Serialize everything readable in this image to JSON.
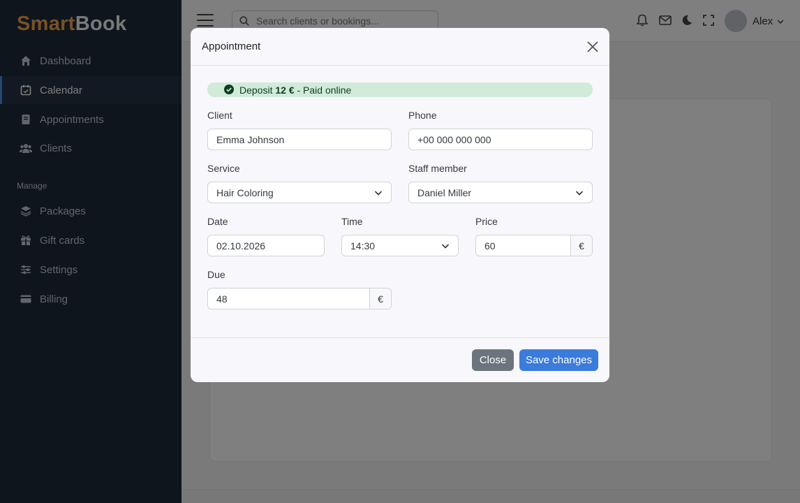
{
  "brand": {
    "part1": "Smart",
    "part2": "Book"
  },
  "sidebar": {
    "items": [
      {
        "label": "Dashboard",
        "icon": "home-icon"
      },
      {
        "label": "Calendar",
        "icon": "calendar-icon",
        "active": true
      },
      {
        "label": "Appointments",
        "icon": "book-icon"
      },
      {
        "label": "Clients",
        "icon": "users-icon"
      }
    ],
    "section_label": "Manage",
    "manage_items": [
      {
        "label": "Packages",
        "icon": "layers-icon"
      },
      {
        "label": "Gift cards",
        "icon": "gift-icon"
      },
      {
        "label": "Settings",
        "icon": "sliders-icon"
      },
      {
        "label": "Billing",
        "icon": "credit-card-icon"
      }
    ]
  },
  "topbar": {
    "search_placeholder": "Search clients or bookings...",
    "user_name": "Alex"
  },
  "modal": {
    "title": "Appointment",
    "alert": {
      "prefix": "Deposit",
      "amount": "12 €",
      "suffix": "- Paid online",
      "color": "#d1ebd9"
    },
    "client": {
      "label": "Client",
      "value": "Emma Johnson"
    },
    "phone": {
      "label": "Phone",
      "value": "+00 000 000 000"
    },
    "service": {
      "label": "Service",
      "value": "Hair Coloring"
    },
    "staff": {
      "label": "Staff member",
      "value": "Daniel Miller"
    },
    "date": {
      "label": "Date",
      "value": "02.10.2026"
    },
    "time": {
      "label": "Time",
      "value": "14:30"
    },
    "price": {
      "label": "Price",
      "value": "60",
      "currency": "€"
    },
    "due": {
      "label": "Due",
      "value": "48",
      "currency": "€"
    },
    "buttons": {
      "close": "Close",
      "save": "Save changes"
    }
  },
  "colors": {
    "primary": "#3a7bdc",
    "secondary": "#6c757d",
    "sidebar": "#1e2a3a",
    "accent": "#f0a34a"
  }
}
